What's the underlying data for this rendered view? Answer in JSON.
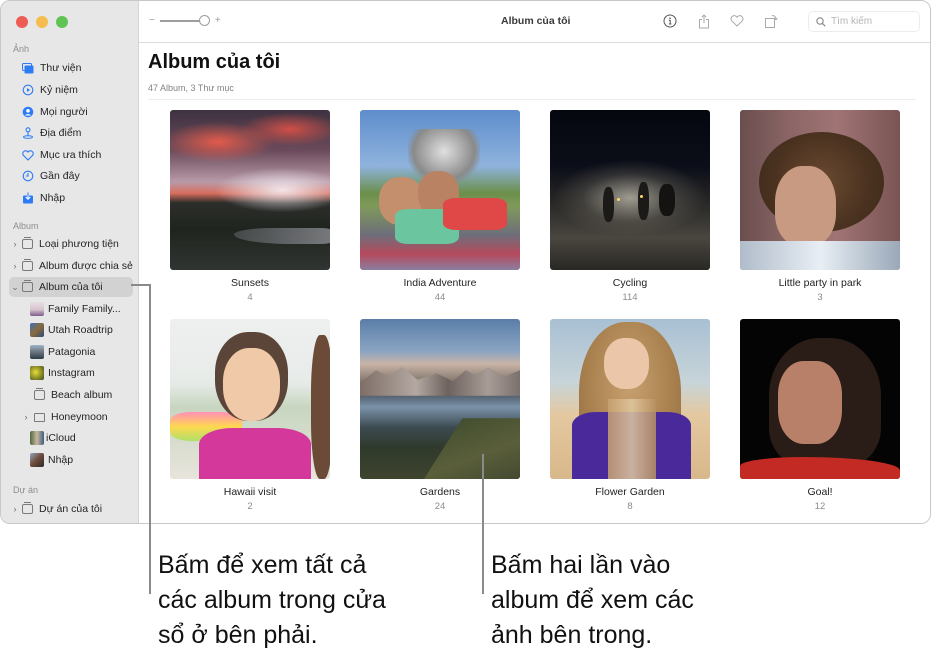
{
  "window": {
    "title": "Album của tôi",
    "traffic_lights": [
      "close",
      "minimize",
      "maximize"
    ]
  },
  "toolbar": {
    "zoom_minus": "−",
    "zoom_plus": "+",
    "zoom_level_percent": 100,
    "title": "Album của tôi",
    "icons": [
      "info-icon",
      "share-icon",
      "heart-icon",
      "rotate-icon"
    ],
    "search_placeholder": "Tìm kiếm"
  },
  "sidebar": {
    "sections": [
      {
        "heading": "Ảnh",
        "items": [
          {
            "label": "Thư viện",
            "icon": "library-icon"
          },
          {
            "label": "Kỷ niệm",
            "icon": "memories-icon"
          },
          {
            "label": "Mọi người",
            "icon": "people-icon"
          },
          {
            "label": "Địa điểm",
            "icon": "places-icon"
          },
          {
            "label": "Mục ưa thích",
            "icon": "heart-icon"
          },
          {
            "label": "Gần đây",
            "icon": "clock-icon"
          },
          {
            "label": "Nhập",
            "icon": "import-icon"
          }
        ]
      },
      {
        "heading": "Album",
        "items": [
          {
            "label": "Loại phương tiện",
            "icon": "album-stack-icon",
            "expandable": true,
            "expanded": false
          },
          {
            "label": "Album được chia sẻ",
            "icon": "shared-album-icon",
            "expandable": true,
            "expanded": false
          },
          {
            "label": "Album của tôi",
            "icon": "album-stack-icon",
            "expandable": true,
            "expanded": true,
            "selected": true
          }
        ],
        "sub_items": [
          {
            "label": "Family Family...",
            "icon": "album-thumbnail"
          },
          {
            "label": "Utah Roadtrip",
            "icon": "album-thumbnail"
          },
          {
            "label": "Patagonia",
            "icon": "album-thumbnail"
          },
          {
            "label": "Instagram",
            "icon": "album-thumbnail"
          },
          {
            "label": "Beach album",
            "icon": "album-stack-icon"
          },
          {
            "label": "Honeymoon",
            "icon": "folder-icon",
            "expandable": true
          },
          {
            "label": "iCloud",
            "icon": "album-thumbnail"
          },
          {
            "label": "Nhập",
            "icon": "album-thumbnail"
          }
        ]
      },
      {
        "heading": "Dự án",
        "items": [
          {
            "label": "Dự án của tôi",
            "icon": "album-stack-icon",
            "expandable": true,
            "expanded": false
          }
        ]
      }
    ]
  },
  "main": {
    "title": "Album của tôi",
    "subtitle": "47 Album, 3 Thư mục",
    "albums": [
      {
        "name": "Sunsets",
        "count": "4"
      },
      {
        "name": "India Adventure",
        "count": "44"
      },
      {
        "name": "Cycling",
        "count": "114"
      },
      {
        "name": "Little party in park",
        "count": "3"
      },
      {
        "name": "Hawaii visit",
        "count": "2"
      },
      {
        "name": "Gardens",
        "count": "24"
      },
      {
        "name": "Flower Garden",
        "count": "8"
      },
      {
        "name": "Goal!",
        "count": "12"
      }
    ]
  },
  "callouts": [
    {
      "lines": [
        "Bấm để xem tất cả",
        "các album trong cửa",
        "sổ ở bên phải."
      ]
    },
    {
      "lines": [
        "Bấm hai lần vào",
        "album để xem các",
        "ảnh bên trong."
      ]
    }
  ]
}
